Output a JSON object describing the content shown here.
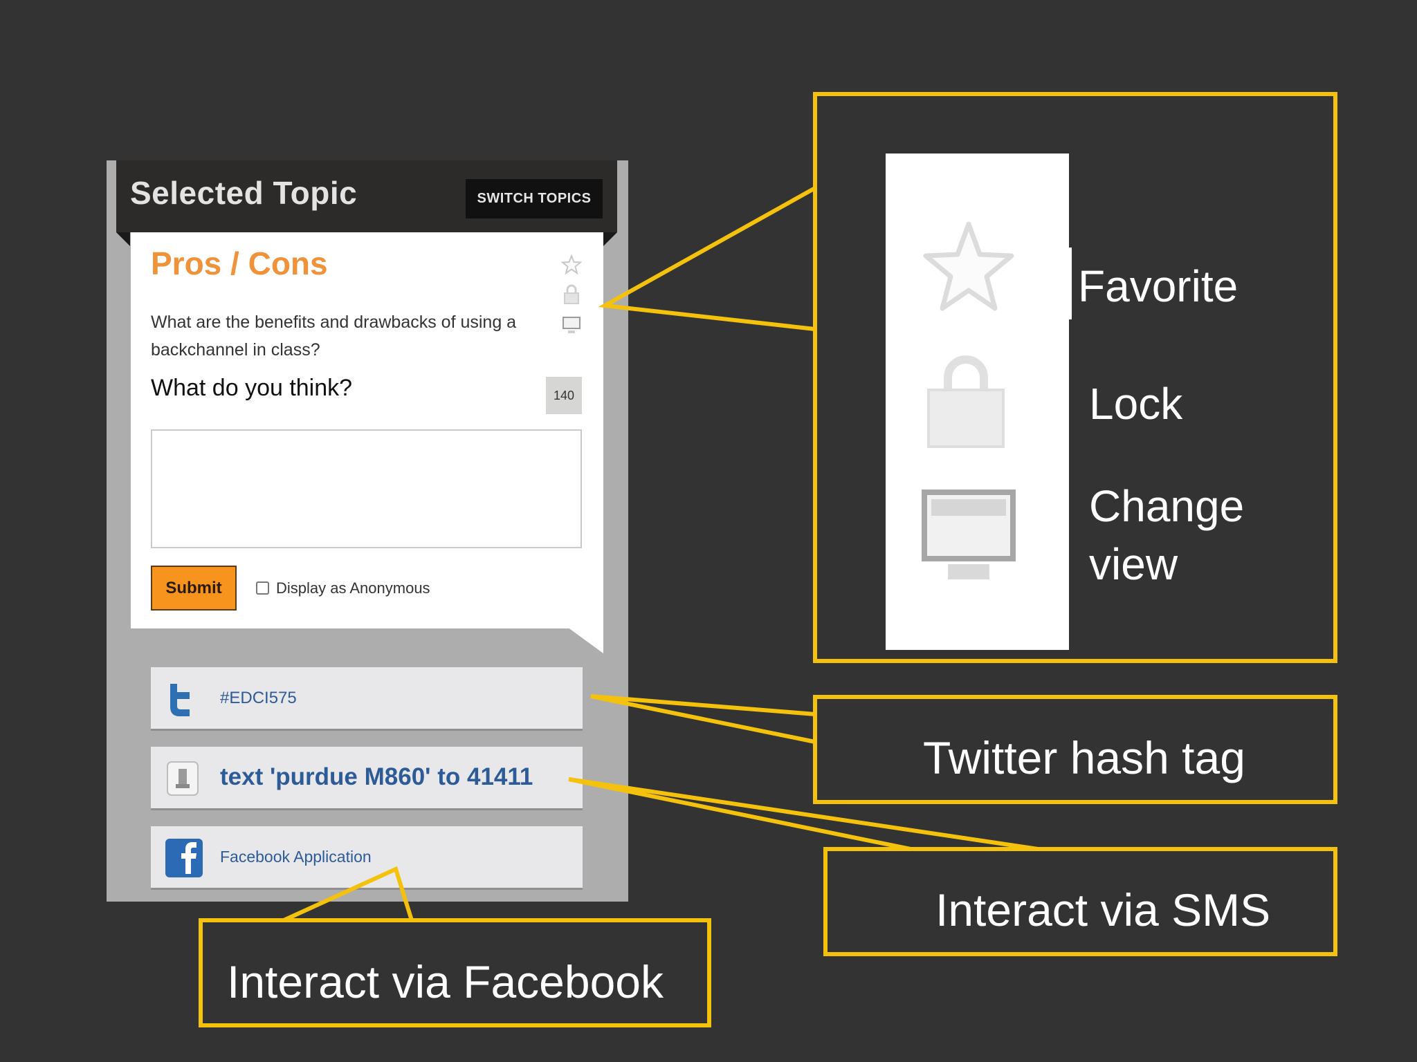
{
  "widget": {
    "header_title": "Selected Topic",
    "switch_topics_label": "SWITCH TOPICS",
    "topic_title": "Pros / Cons",
    "topic_question": "What are the benefits and drawbacks of using a backchannel in class?",
    "prompt": "What do you think?",
    "char_count": "140",
    "answer_value": "",
    "submit_label": "Submit",
    "anonymous_label": "Display as Anonymous",
    "anonymous_checked": false,
    "icons": [
      "star-icon",
      "lock-icon",
      "monitor-icon"
    ]
  },
  "channels": {
    "twitter": {
      "text": "#EDCI575",
      "icon": "twitter-icon"
    },
    "sms": {
      "text": "text 'purdue M860' to 41411",
      "icon": "phone-icon"
    },
    "facebook": {
      "text": "Facebook Application",
      "icon": "facebook-icon"
    }
  },
  "callouts": {
    "favorite": "Favorite",
    "lock": "Lock",
    "change_view": "Change\nview",
    "twitter": "Twitter hash tag",
    "sms": "Interact via SMS",
    "facebook": "Interact via Facebook"
  },
  "colors": {
    "background": "#333333",
    "callout_border": "#f4c20d",
    "topic_orange": "#f0923a",
    "submit_orange": "#f7941d",
    "link_blue": "#2d5b97"
  }
}
